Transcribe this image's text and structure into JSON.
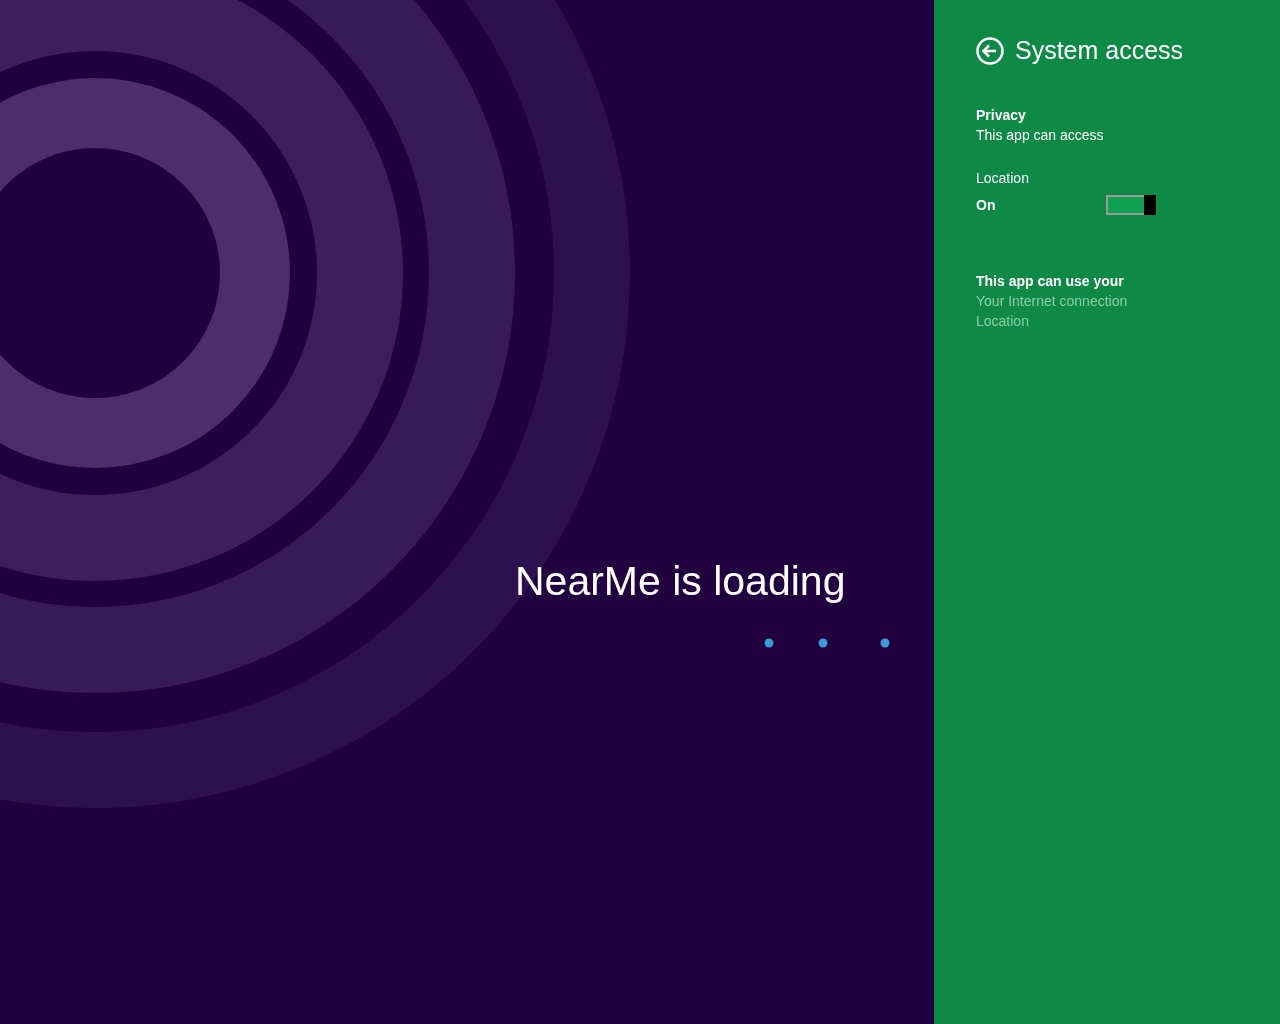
{
  "splash": {
    "message": "NearMe is loading"
  },
  "panel": {
    "title": "System access",
    "privacy": {
      "heading": "Privacy",
      "subtitle": "This app can access"
    },
    "settings": [
      {
        "label": "Location",
        "value": "On",
        "on": true
      }
    ],
    "capabilities": {
      "heading": "This app can use your",
      "items": [
        "Your Internet connection",
        "Location"
      ]
    }
  }
}
